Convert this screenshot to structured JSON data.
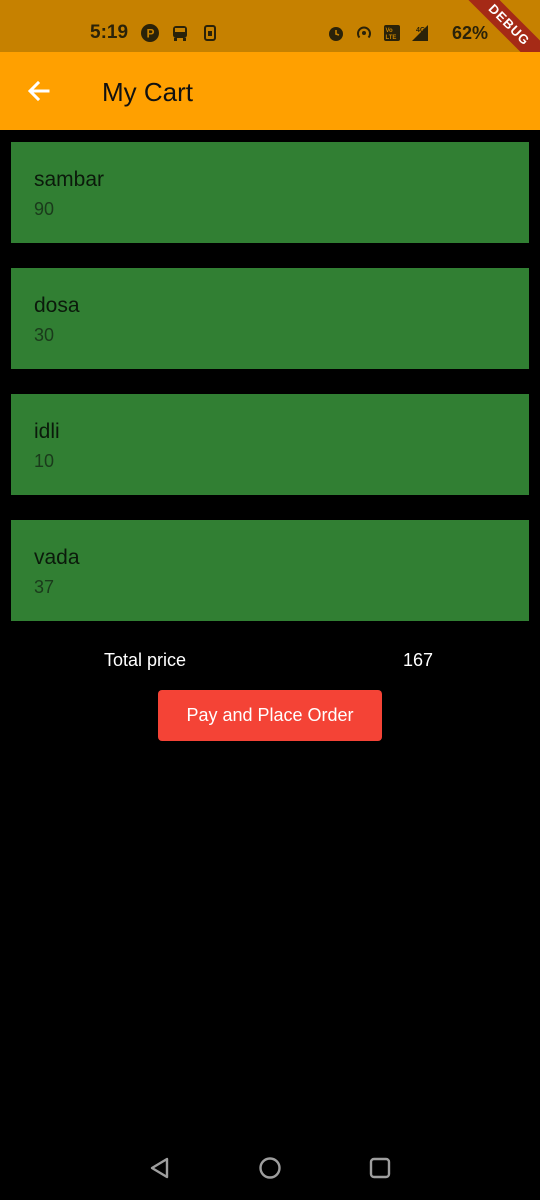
{
  "status_bar": {
    "time": "5:19",
    "battery": "62%",
    "icons": [
      "p-icon",
      "transit-icon",
      "sim-icon",
      "alarm-icon",
      "hotspot-icon",
      "volte-icon",
      "signal-4g-icon"
    ]
  },
  "debug_banner": "DEBUG",
  "app_bar": {
    "title": "My Cart",
    "back_icon": "arrow-back-icon"
  },
  "cart": {
    "items": [
      {
        "name": "sambar",
        "price": "90"
      },
      {
        "name": "dosa",
        "price": "30"
      },
      {
        "name": "idli",
        "price": "10"
      },
      {
        "name": "vada",
        "price": "37"
      }
    ]
  },
  "summary": {
    "total_label": "Total price",
    "total_value": "167"
  },
  "actions": {
    "pay_label": "Pay and Place Order"
  },
  "colors": {
    "app_bar": "#ffa000",
    "status_bar": "#c68100",
    "item_background": "#317f33",
    "pay_button": "#f44336",
    "background": "#000000"
  },
  "nav_bar": {
    "icons": [
      "back-triangle-icon",
      "home-circle-icon",
      "recents-square-icon"
    ]
  }
}
